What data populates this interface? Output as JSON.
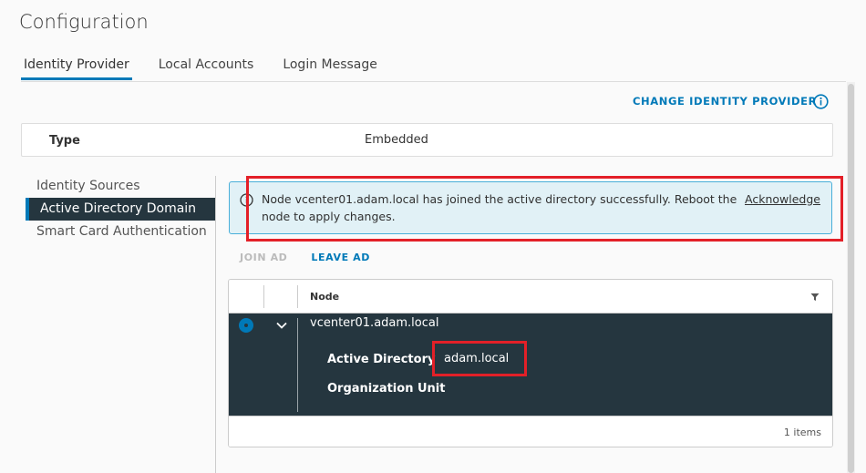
{
  "page": {
    "title": "Configuration"
  },
  "tabs": [
    {
      "label": "Identity Provider",
      "active": true
    },
    {
      "label": "Local Accounts",
      "active": false
    },
    {
      "label": "Login Message",
      "active": false
    }
  ],
  "toolbar": {
    "change_identity_provider": "CHANGE IDENTITY PROVIDER",
    "info_icon": "info-circle-icon"
  },
  "type_card": {
    "label": "Type",
    "value": "Embedded"
  },
  "left_nav": {
    "items": [
      {
        "label": "Identity Sources",
        "active": false
      },
      {
        "label": "Active Directory Domain",
        "active": true
      },
      {
        "label": "Smart Card Authentication",
        "active": false
      }
    ]
  },
  "alert": {
    "icon": "info-circle-icon",
    "message": "Node vcenter01.adam.local has joined the active directory successfully. Reboot the node to apply changes.",
    "action": "Acknowledge"
  },
  "actions": {
    "join_ad": "JOIN AD",
    "leave_ad": "LEAVE AD"
  },
  "grid": {
    "columns": [
      "Node"
    ],
    "rows": [
      {
        "node": "vcenter01.adam.local",
        "selected": true,
        "expanded": true,
        "details": [
          {
            "label": "Active Directory",
            "value": "adam.local"
          },
          {
            "label": "Organization Unit",
            "value": ""
          }
        ]
      }
    ],
    "footer": "1 items"
  },
  "colors": {
    "accent": "#0079b8",
    "highlight": "#e32028",
    "selected_row": "#25363f",
    "alert_bg": "#e1f1f6"
  }
}
